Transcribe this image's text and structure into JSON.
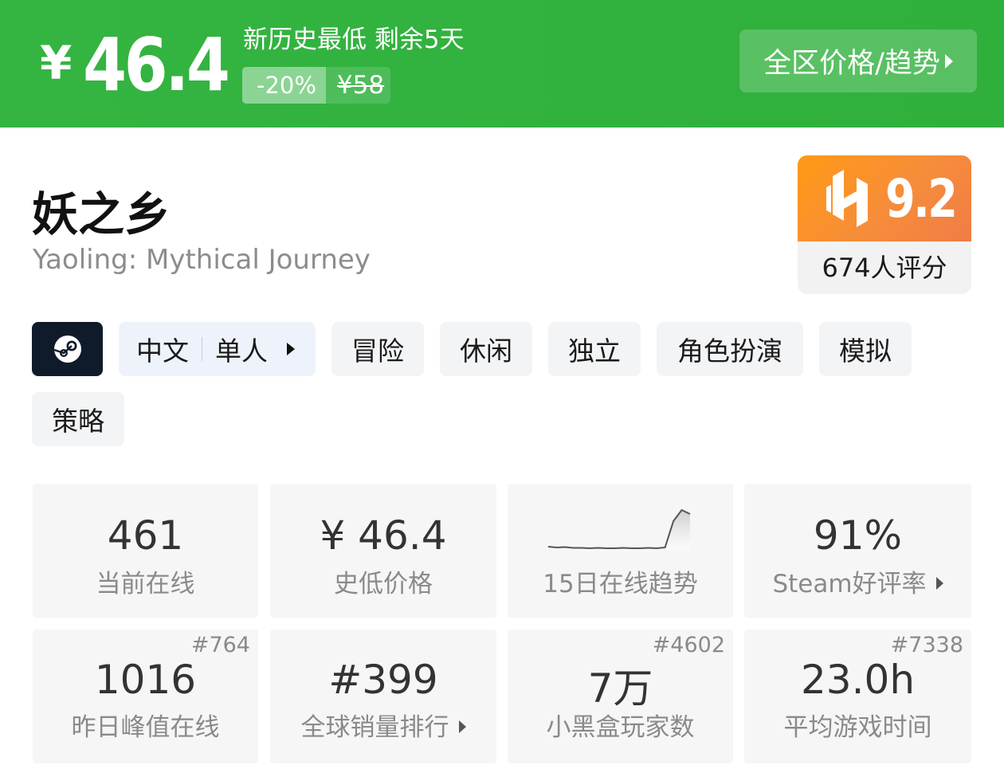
{
  "banner": {
    "currency": "¥",
    "price": "46.4",
    "low_note": "新历史最低 剩余5天",
    "discount": "-20%",
    "original_price": "¥58",
    "trend_button": "全区价格/趋势",
    "bg_color": "#2fb03c"
  },
  "game": {
    "title": "妖之乡",
    "subtitle": "Yaoling: Mythical Journey"
  },
  "score": {
    "value": "9.2",
    "count_text": "674人评分",
    "accent": "#f7931e"
  },
  "tags": {
    "platform_icon": "steam-icon",
    "language": "中文",
    "mode": "单人",
    "genres": [
      "冒险",
      "休闲",
      "独立",
      "角色扮演",
      "模拟",
      "策略"
    ]
  },
  "stats": [
    {
      "value": "461",
      "label": "当前在线"
    },
    {
      "value": "¥ 46.4",
      "label": "史低价格"
    },
    {
      "value": "",
      "label": "15日在线趋势",
      "sparkline": [
        0.08,
        0.06,
        0.07,
        0.05,
        0.05,
        0.04,
        0.05,
        0.04,
        0.04,
        0.05,
        0.04,
        0.04,
        0.05,
        0.04,
        0.06,
        0.72,
        1.0,
        0.9
      ]
    },
    {
      "value": "91%",
      "label": "Steam好评率"
    },
    {
      "value": "1016",
      "label": "昨日峰值在线",
      "rank": "#764"
    },
    {
      "value": "#399",
      "label": "全球销量排行"
    },
    {
      "value": "7万",
      "label": "小黑盒玩家数",
      "rank": "#4602"
    },
    {
      "value": "23.0h",
      "label": "平均游戏时间",
      "rank": "#7338"
    }
  ]
}
